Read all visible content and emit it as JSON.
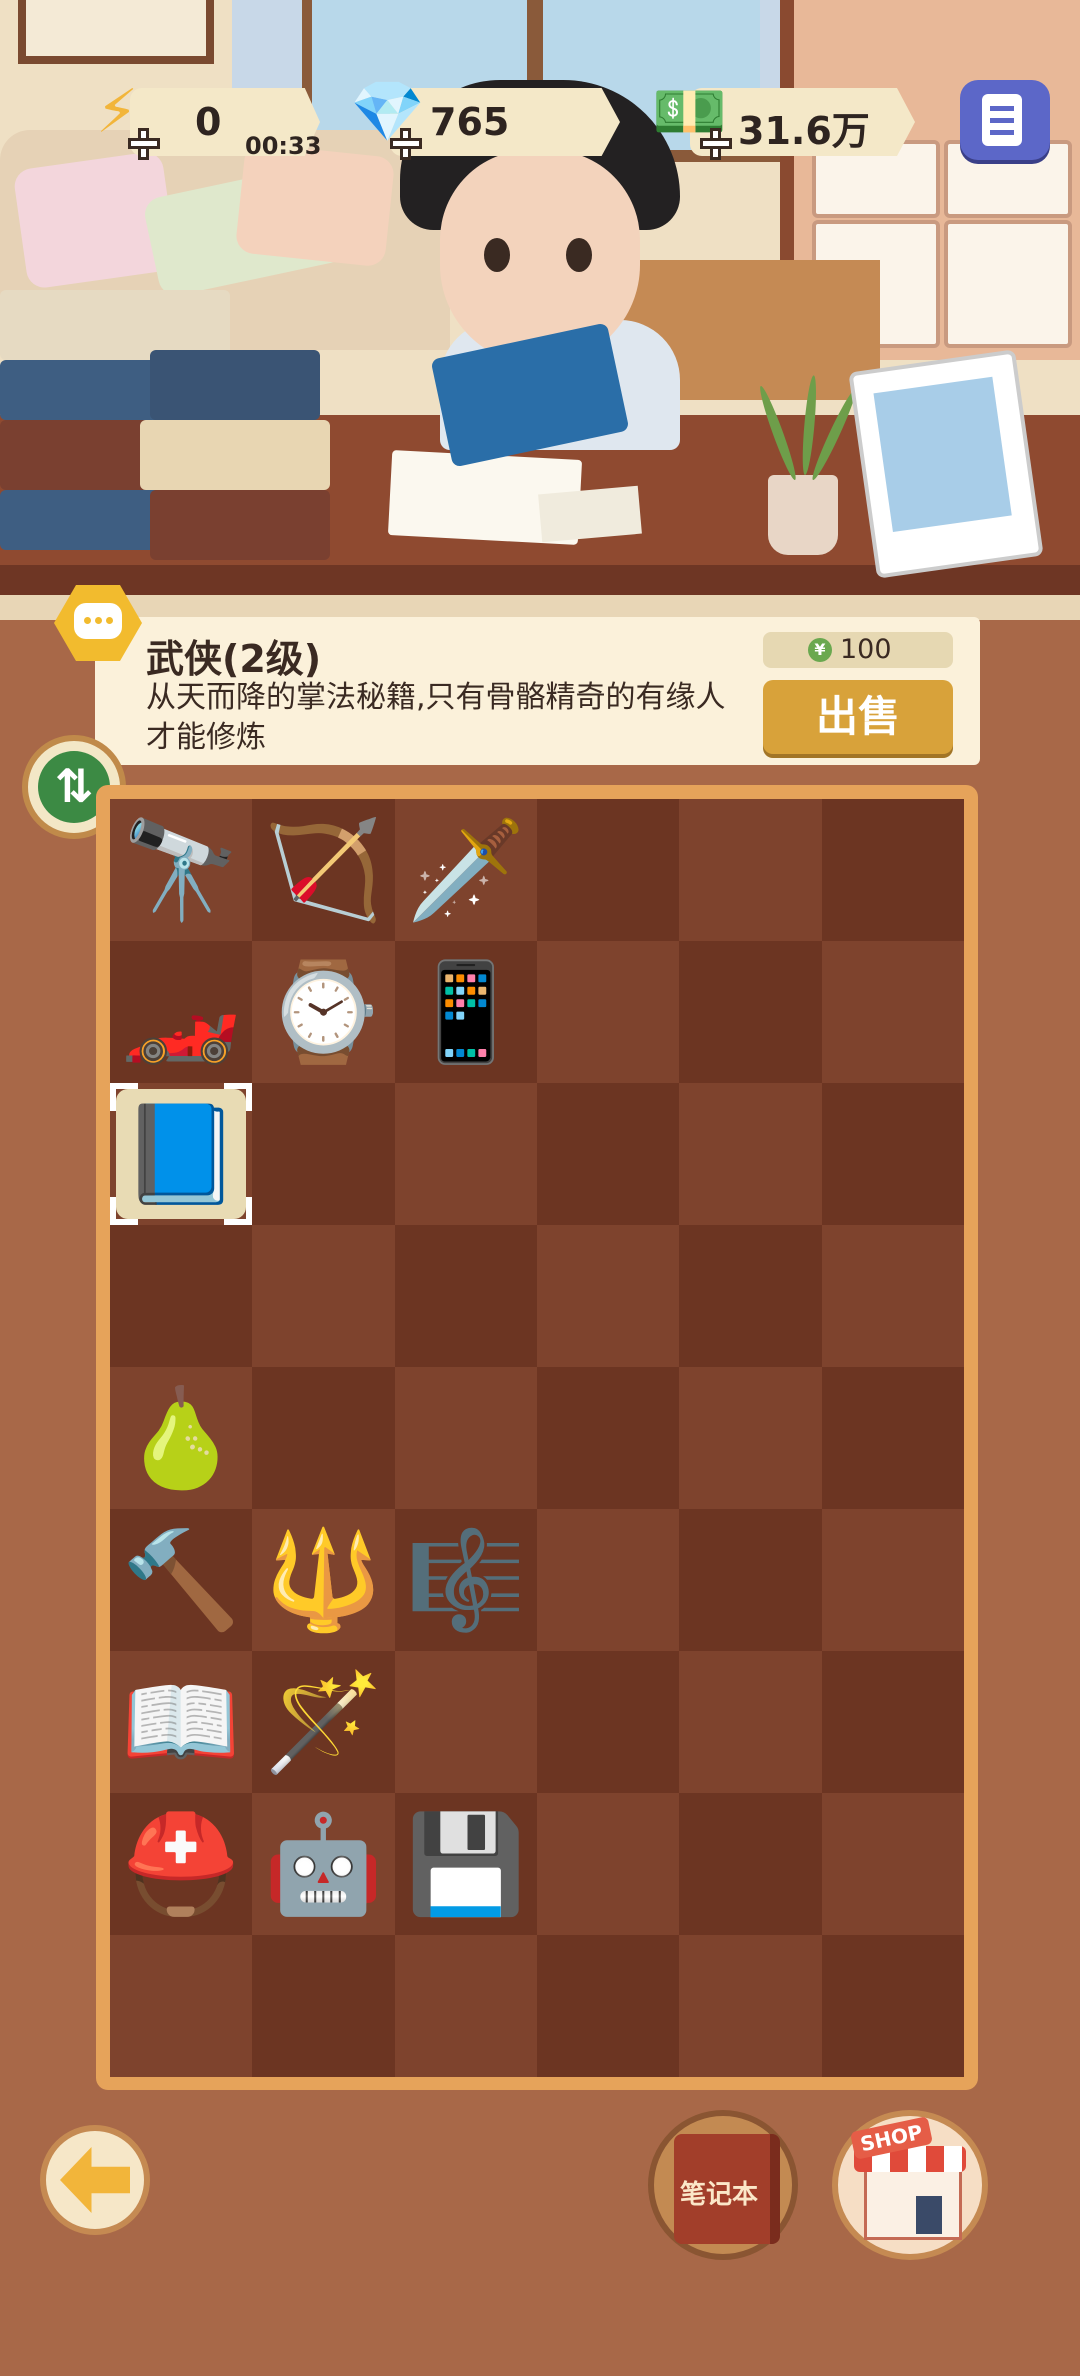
{
  "hud": {
    "energy": {
      "value": "0",
      "timer": "00:33",
      "icon": "lightning-icon"
    },
    "gems": {
      "value": "765",
      "icon": "gem-icon"
    },
    "cash": {
      "value": "31.6万",
      "icon": "cash-icon"
    },
    "notes_icon": "notes-icon"
  },
  "item_info": {
    "title": "武侠(2级)",
    "description": "从天而降的掌法秘籍,只有骨骼精奇的有缘人才能修炼",
    "price": "100",
    "sell_label": "出售"
  },
  "inventory": {
    "columns": 6,
    "rows": 9,
    "cells": [
      [
        "🔭",
        "🏹",
        "🗡️",
        "",
        "",
        ""
      ],
      [
        "🏎️",
        "⌚",
        "📱",
        "",
        "",
        ""
      ],
      [
        "📘",
        "",
        "",
        "",
        "",
        ""
      ],
      [
        "",
        "",
        "",
        "",
        "",
        ""
      ],
      [
        "🍐",
        "",
        "",
        "",
        "",
        ""
      ],
      [
        "🔨",
        "🔱",
        "🎼",
        "",
        "",
        ""
      ],
      [
        "📖",
        "🪄",
        "",
        "",
        "",
        ""
      ],
      [
        "⛑️",
        "🤖",
        "💾",
        "",
        "",
        ""
      ],
      [
        "",
        "",
        "",
        "",
        "",
        ""
      ]
    ],
    "names": [
      [
        "cannon",
        "bow",
        "sword",
        "",
        "",
        ""
      ],
      [
        "sports-car",
        "wristwatch",
        "cell-phone",
        "",
        "",
        ""
      ],
      [
        "martial-arts-manual",
        "",
        "",
        "",
        "",
        ""
      ],
      [
        "",
        "",
        "",
        "",
        "",
        ""
      ],
      [
        "gourd",
        "",
        "",
        "",
        "",
        ""
      ],
      [
        "hammer",
        "trident",
        "lyre",
        "",
        "",
        ""
      ],
      [
        "magic-book",
        "magic-staff",
        "",
        "",
        "",
        ""
      ],
      [
        "stormtrooper-helmet",
        "robot",
        "microchip",
        "",
        "",
        ""
      ],
      [
        "",
        "",
        "",
        "",
        "",
        ""
      ]
    ],
    "selected": [
      2,
      0
    ]
  },
  "bottom": {
    "notebook_label": "笔记本",
    "shop_label": "SHOP"
  },
  "colors": {
    "cell_light": "#7e432d",
    "cell_dark": "#6c3522",
    "sell_button": "#d8a23a",
    "board_border": "#e6a35a"
  }
}
